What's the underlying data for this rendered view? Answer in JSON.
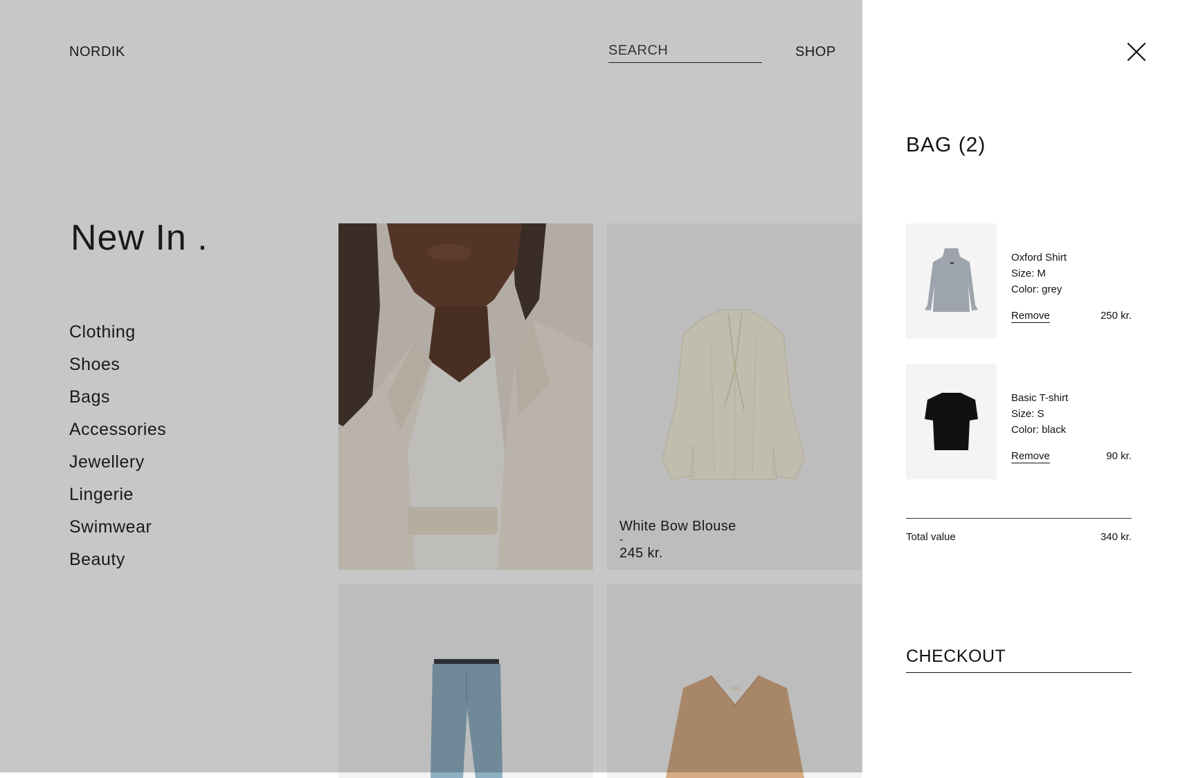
{
  "header": {
    "brand": "NORDIK",
    "search_placeholder": "SEARCH",
    "shop_label": "SHOP"
  },
  "hero": {
    "title": "New In ."
  },
  "categories": [
    "Clothing",
    "Shoes",
    "Bags",
    "Accessories",
    "Jewellery",
    "Lingerie",
    "Swimwear",
    "Beauty"
  ],
  "products": [
    {
      "name": "White Bow Blouse",
      "separator": "-",
      "price": "245 kr."
    }
  ],
  "bag": {
    "title": "BAG (2)",
    "items": [
      {
        "name": "Oxford Shirt",
        "size": "Size: M",
        "color": "Color: grey",
        "remove": "Remove",
        "price": "250 kr."
      },
      {
        "name": "Basic T-shirt",
        "size": "Size: S",
        "color": "Color: black",
        "remove": "Remove",
        "price": "90 kr."
      }
    ],
    "total_label": "Total value",
    "total_value": "340 kr.",
    "checkout_label": "CHECKOUT"
  },
  "icons": {
    "close": "close-icon"
  },
  "colors": {
    "overlay": "#000000",
    "drawer_bg": "#ffffff",
    "tile_bg": "#f3f3f3",
    "text": "#111111"
  }
}
